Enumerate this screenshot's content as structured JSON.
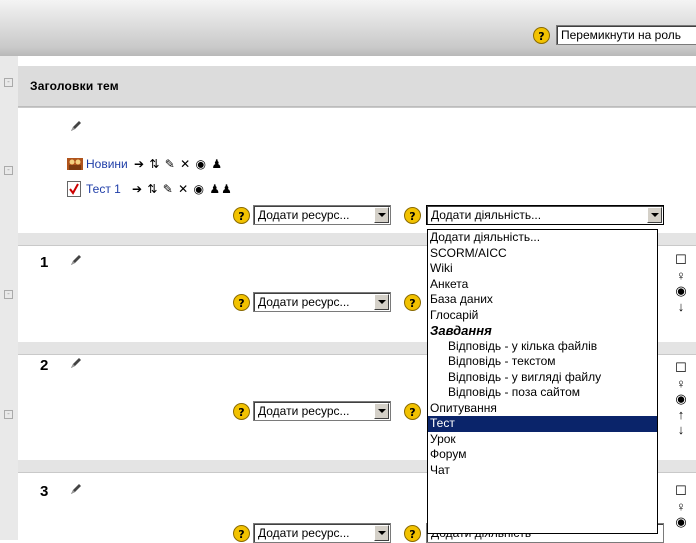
{
  "topbar": {
    "switch_role": "Перемикнути на роль"
  },
  "header": {
    "title": "Заголовки тем"
  },
  "section0": {
    "items": [
      {
        "label": "Новини",
        "controls": "➔ ⇅ ✎ ✕ ◉ ♟"
      },
      {
        "label": "Тест 1",
        "controls": "➔ ⇅ ✎ ✕ ◉ ♟♟"
      }
    ]
  },
  "sections": [
    {
      "number": "1"
    },
    {
      "number": "2"
    },
    {
      "number": "3"
    }
  ],
  "add_resource": "Додати ресурс...",
  "add_activity": "Додати діяльність...",
  "add_activity_partial": "Додати діяльність",
  "activity_options": [
    "Додати діяльність...",
    "SCORM/AICC",
    "Wiki",
    "Анкета",
    "База даних",
    "Глосарій",
    "Завдання",
    "Відповідь - у кілька файлів",
    "Відповідь - текстом",
    "Відповідь - у вигляді файлу",
    "Відповідь - поза сайтом",
    "Опитування",
    "Тест",
    "Урок",
    "Форум",
    "Чат"
  ],
  "selected_option": "Тест",
  "colors": {
    "header_bg": "#dcdcdc",
    "link": "#1f3ea8",
    "selection": "#0a246a",
    "help_icon": "#f2c200"
  }
}
